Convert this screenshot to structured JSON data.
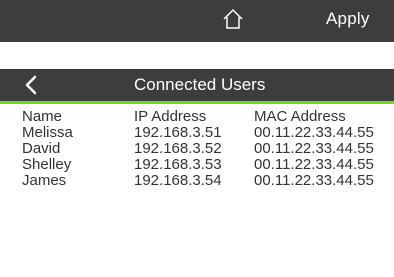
{
  "toolbar": {
    "home_icon": "home-icon",
    "apply_label": "Apply"
  },
  "panel": {
    "back_icon": "chevron-left-icon",
    "title": "Connected Users",
    "accent_color": "#7ed321"
  },
  "table": {
    "headers": [
      "Name",
      "IP Address",
      "MAC Address"
    ],
    "rows": [
      [
        "Melissa",
        "192.168.3.51",
        "00.11.22.33.44.55"
      ],
      [
        "David",
        "192.168.3.52",
        "00.11.22.33.44.55"
      ],
      [
        "Shelley",
        "192.168.3.53",
        "00.11.22.33.44.55"
      ],
      [
        "James",
        "192.168.3.54",
        "00.11.22.33.44.55"
      ]
    ]
  }
}
